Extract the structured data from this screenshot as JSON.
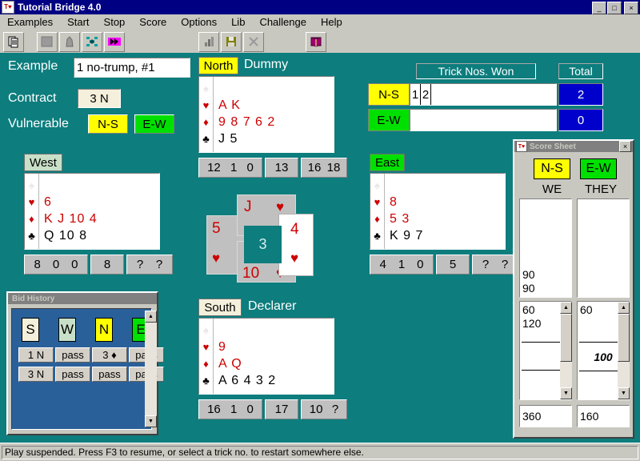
{
  "window": {
    "title": "Tutorial Bridge 4.0",
    "icon": "club-heart-icon",
    "minimize": "_",
    "maximize": "□",
    "close": "×"
  },
  "menubar": {
    "items": [
      {
        "label": "Examples"
      },
      {
        "label": "Start"
      },
      {
        "label": "Stop"
      },
      {
        "label": "Score"
      },
      {
        "label": "Options"
      },
      {
        "label": "Lib"
      },
      {
        "label": "Challenge"
      },
      {
        "label": "Help"
      }
    ]
  },
  "toolbar": {
    "buttons": [
      {
        "name": "copy-icon"
      },
      {
        "name": "card-back-icon"
      },
      {
        "name": "hand-icon"
      },
      {
        "name": "deal-icon"
      },
      {
        "name": "fast-forward-icon"
      },
      {
        "name": "chart-icon"
      },
      {
        "name": "save-icon"
      },
      {
        "name": "close-x-icon"
      },
      {
        "name": "book-icon"
      }
    ]
  },
  "info": {
    "example_label": "Example",
    "example_value": "1 no-trump, #1",
    "contract_label": "Contract",
    "contract_value": "3 N",
    "vulnerable_label": "Vulnerable",
    "vul_ns": "N-S",
    "vul_ew": "E-W",
    "vul_ns_color": "#ffff00",
    "vul_ew_color": "#00e000"
  },
  "tricks": {
    "header": "Trick Nos. Won",
    "total_header": "Total",
    "rows": [
      {
        "side": "N-S",
        "side_color": "#ffff00",
        "cells": [
          "1",
          "2"
        ],
        "total": "2"
      },
      {
        "side": "E-W",
        "side_color": "#00e000",
        "cells": [],
        "total": "0"
      }
    ]
  },
  "hands": {
    "north": {
      "seat": "North",
      "seat_color": "#ffff00",
      "role": "Dummy",
      "suits": [
        {
          "symbol": "♠",
          "cls": "s-spade",
          "cards": "",
          "color": "blk"
        },
        {
          "symbol": "♥",
          "cls": "s-heart",
          "cards": "A K",
          "color": "red"
        },
        {
          "symbol": "♦",
          "cls": "s-diam",
          "cards": "9 8 7 6 2",
          "color": "red"
        },
        {
          "symbol": "♣",
          "cls": "s-club",
          "cards": "J 5",
          "color": "blk"
        }
      ],
      "stats_a": [
        "12",
        "1",
        "0"
      ],
      "stats_b": [
        "13"
      ],
      "stats_c": [
        "16",
        "18"
      ]
    },
    "west": {
      "seat": "West",
      "seat_color": "#c8e0c8",
      "role": "",
      "suits": [
        {
          "symbol": "♠",
          "cls": "s-spade",
          "cards": "",
          "color": "blk"
        },
        {
          "symbol": "♥",
          "cls": "s-heart",
          "cards": "6",
          "color": "red"
        },
        {
          "symbol": "♦",
          "cls": "s-diam",
          "cards": "K J 10 4",
          "color": "red"
        },
        {
          "symbol": "♣",
          "cls": "s-club",
          "cards": "Q 10 8",
          "color": "blk"
        }
      ],
      "stats_a": [
        "8",
        "0",
        "0"
      ],
      "stats_b": [
        "8"
      ],
      "stats_c": [
        "?",
        "?"
      ]
    },
    "east": {
      "seat": "East",
      "seat_color": "#00e000",
      "role": "",
      "suits": [
        {
          "symbol": "♠",
          "cls": "s-spade",
          "cards": "",
          "color": "blk"
        },
        {
          "symbol": "♥",
          "cls": "s-heart",
          "cards": "8",
          "color": "red"
        },
        {
          "symbol": "♦",
          "cls": "s-diam",
          "cards": "5 3",
          "color": "red"
        },
        {
          "symbol": "♣",
          "cls": "s-club",
          "cards": "K 9 7",
          "color": "blk"
        }
      ],
      "stats_a": [
        "4",
        "1",
        "0"
      ],
      "stats_b": [
        "5"
      ],
      "stats_c": [
        "?",
        "?"
      ]
    },
    "south": {
      "seat": "South",
      "seat_color": "#f5f0dc",
      "role": "Declarer",
      "suits": [
        {
          "symbol": "♠",
          "cls": "s-spade",
          "cards": "",
          "color": "blk"
        },
        {
          "symbol": "♥",
          "cls": "s-heart",
          "cards": "9",
          "color": "red"
        },
        {
          "symbol": "♦",
          "cls": "s-diam",
          "cards": "A Q",
          "color": "red"
        },
        {
          "symbol": "♣",
          "cls": "s-club",
          "cards": "A 6 4 3 2",
          "color": "blk"
        }
      ],
      "stats_a": [
        "16",
        "1",
        "0"
      ],
      "stats_b": [
        "17"
      ],
      "stats_c": [
        "10",
        "?"
      ]
    }
  },
  "trick_area": {
    "trick_number": "3",
    "cards": [
      {
        "position": "north",
        "rank": "J",
        "suit": "♥",
        "played": false
      },
      {
        "position": "east",
        "rank": "4",
        "suit": "♥",
        "played": true
      },
      {
        "position": "south",
        "rank": "10",
        "suit": "♥",
        "played": false
      },
      {
        "position": "west",
        "rank": "5",
        "suit": "♥",
        "played": false
      }
    ]
  },
  "bid_history": {
    "title": "Bid History",
    "headers": [
      {
        "label": "S",
        "color": "#f5f0dc"
      },
      {
        "label": "W",
        "color": "#c8e0c8"
      },
      {
        "label": "N",
        "color": "#ffff00"
      },
      {
        "label": "E",
        "color": "#00e000"
      }
    ],
    "rows": [
      [
        "1 N",
        "pass",
        "3 ♦",
        "pass"
      ],
      [
        "3 N",
        "pass",
        "pass",
        "pass"
      ]
    ]
  },
  "score_sheet": {
    "title": "Score Sheet",
    "close": "×",
    "badge_ns": "N-S",
    "badge_ew": "E-W",
    "badge_ns_color": "#ffff00",
    "badge_ew_color": "#00e000",
    "col_we": "WE",
    "col_they": "THEY",
    "above_we": [
      "90",
      "90"
    ],
    "above_they": [],
    "below_we": [
      "60",
      "120"
    ],
    "below_they": [
      "60"
    ],
    "below_they_italic": "100",
    "total_we": "360",
    "total_they": "160"
  },
  "statusbar": {
    "message": "Play suspended. Press F3 to resume, or select a trick no. to restart somewhere else."
  }
}
